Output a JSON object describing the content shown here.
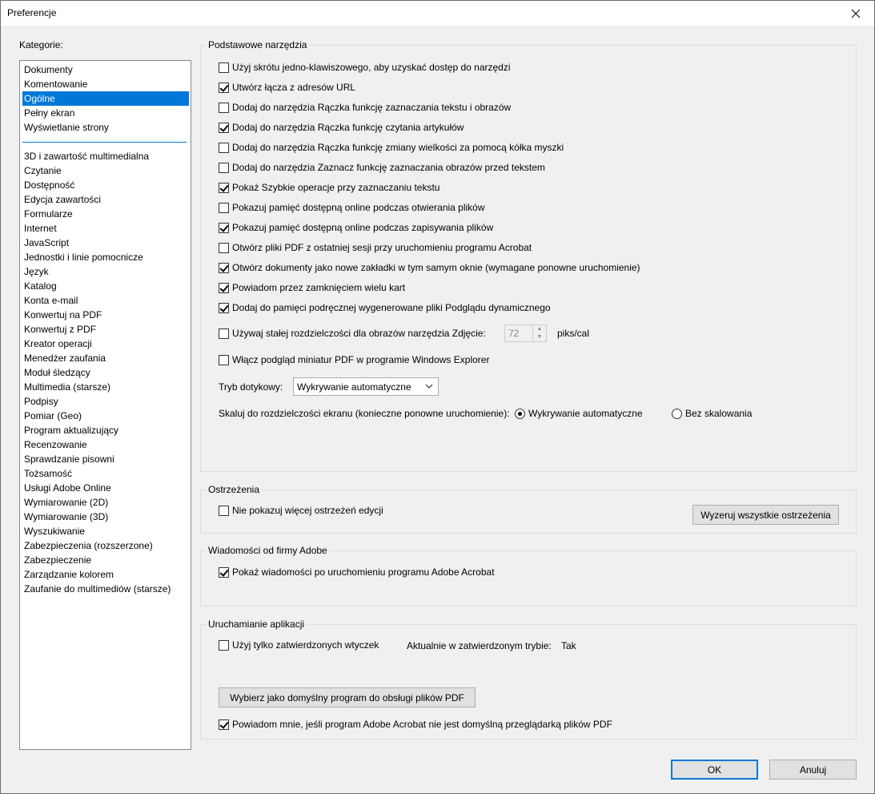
{
  "window": {
    "title": "Preferencje"
  },
  "categories": {
    "label": "Kategorie:",
    "top_items": [
      "Dokumenty",
      "Komentowanie",
      "Ogólne",
      "Pełny ekran",
      "Wyświetlanie strony"
    ],
    "selected": "Ogólne",
    "items": [
      "3D i zawartość multimedialna",
      "Czytanie",
      "Dostępność",
      "Edycja zawartości",
      "Formularze",
      "Internet",
      "JavaScript",
      "Jednostki i linie pomocnicze",
      "Język",
      "Katalog",
      "Konta e-mail",
      "Konwertuj na PDF",
      "Konwertuj z PDF",
      "Kreator operacji",
      "Menedżer zaufania",
      "Moduł śledzący",
      "Multimedia (starsze)",
      "Podpisy",
      "Pomiar (Geo)",
      "Program aktualizujący",
      "Recenzowanie",
      "Sprawdzanie pisowni",
      "Tożsamość",
      "Usługi Adobe Online",
      "Wymiarowanie (2D)",
      "Wymiarowanie (3D)",
      "Wyszukiwanie",
      "Zabezpieczenia (rozszerzone)",
      "Zabezpieczenie",
      "Zarządzanie kolorem",
      "Zaufanie do multimediów (starsze)"
    ]
  },
  "basic_tools": {
    "legend": "Podstawowe narzędzia",
    "options": [
      {
        "label": "Użyj skrótu jedno-klawiszowego, aby uzyskać dostęp do narzędzi",
        "checked": false
      },
      {
        "label": "Utwórz łącza z adresów URL",
        "checked": true
      },
      {
        "label": "Dodaj do narzędzia Rączka funkcję zaznaczania tekstu i obrazów",
        "checked": false
      },
      {
        "label": "Dodaj do narzędzia Rączka funkcję czytania artykułów",
        "checked": true
      },
      {
        "label": "Dodaj do narzędzia Rączka funkcję zmiany wielkości za pomocą kółka myszki",
        "checked": false
      },
      {
        "label": "Dodaj do narzędzia Zaznacz funkcję zaznaczania obrazów przed tekstem",
        "checked": false
      },
      {
        "label": "Pokaż Szybkie operacje przy zaznaczaniu tekstu",
        "checked": true
      },
      {
        "label": "Pokazuj pamięć dostępną online podczas otwierania plików",
        "checked": false
      },
      {
        "label": "Pokazuj pamięć dostępną online podczas zapisywania plików",
        "checked": true
      },
      {
        "label": "Otwórz pliki PDF z ostatniej sesji przy uruchomieniu programu Acrobat",
        "checked": false
      },
      {
        "label": "Otwórz dokumenty jako nowe zakładki w tym samym oknie (wymagane ponowne uruchomienie)",
        "checked": true
      },
      {
        "label": "Powiadom przez zamknięciem wielu kart",
        "checked": true
      },
      {
        "label": "Dodaj do pamięci podręcznej wygenerowane pliki Podglądu dynamicznego",
        "checked": true
      }
    ],
    "resolution": {
      "label": "Używaj stałej rozdzielczości dla obrazów narzędzia Zdjęcie:",
      "checked": false,
      "value": "72",
      "unit": "piks/cal"
    },
    "thumbnails": {
      "label": "Włącz podgląd miniatur PDF w programie Windows Explorer",
      "checked": false
    },
    "touch_mode": {
      "label": "Tryb dotykowy:",
      "value": "Wykrywanie automatyczne"
    },
    "scaling": {
      "label": "Skaluj do rozdzielczości ekranu (konieczne ponowne uruchomienie):",
      "options": [
        {
          "label": "Wykrywanie automatyczne",
          "checked": true
        },
        {
          "label": "Bez skalowania",
          "checked": false
        }
      ]
    }
  },
  "warnings": {
    "legend": "Ostrzeżenia",
    "option": {
      "label": "Nie pokazuj więcej ostrzeżeń edycji",
      "checked": false
    },
    "reset_button": "Wyzeruj wszystkie ostrzeżenia"
  },
  "adobe_messages": {
    "legend": "Wiadomości od firmy Adobe",
    "option": {
      "label": "Pokaż wiadomości po uruchomieniu programu Adobe Acrobat",
      "checked": true
    }
  },
  "app_startup": {
    "legend": "Uruchamianie aplikacji",
    "option": {
      "label": "Użyj tylko zatwierdzonych wtyczek",
      "checked": false
    },
    "status_label": "Aktualnie w zatwierdzonym trybie:",
    "status_value": "Tak",
    "default_button": "Wybierz jako domyślny program do obsługi plików PDF",
    "notify": {
      "label": "Powiadom mnie, jeśli program Adobe Acrobat nie jest domyślną przeglądarką plików PDF",
      "checked": true
    }
  },
  "footer": {
    "ok": "OK",
    "cancel": "Anuluj"
  }
}
